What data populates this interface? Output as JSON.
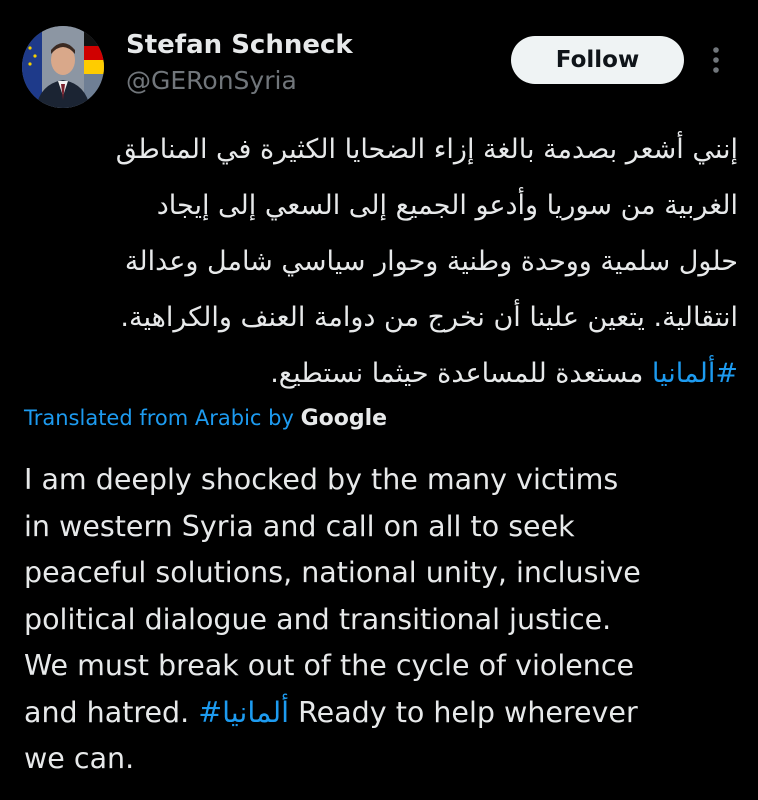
{
  "author": {
    "name": "Stefan Schneck",
    "handle": "@GERonSyria",
    "avatar_icon": "profile-photo-with-flags"
  },
  "follow_label": "Follow",
  "more_icon": "more-vertical-icon",
  "arabic_text": {
    "line1": "إنني أشعر بصدمة بالغة إزاء الضحايا الكثيرة في المناطق",
    "line2": "الغربية من سوريا وأدعو الجميع إلى السعي إلى إيجاد",
    "line3": "حلول سلمية ووحدة وطنية وحوار سياسي شامل وعدالة",
    "line4": "انتقالية. يتعين علينا أن نخرج من دوامة العنف والكراهية.",
    "line5_hashtag": "#ألمانيا",
    "line5_rest": " مستعدة للمساعدة حيثما نستطيع."
  },
  "translation": {
    "label": "Translated from Arabic by ",
    "provider": "Google"
  },
  "english_text": {
    "line1": "I am deeply shocked by the many victims",
    "line2": "in western Syria and call on all to seek",
    "line3": "peaceful solutions, national unity, inclusive",
    "line4": "political dialogue and transitional justice.",
    "line5": "We must break out of the cycle of violence",
    "line6_pre": "and hatred. ",
    "line6_hashtag": "#ألمانيا",
    "line6_post": " Ready to help wherever",
    "line7": "we can."
  },
  "colors": {
    "background": "#000000",
    "text": "#e7e9ea",
    "secondary": "#71767b",
    "link": "#1d9bf0",
    "button_bg": "#eff3f4"
  }
}
